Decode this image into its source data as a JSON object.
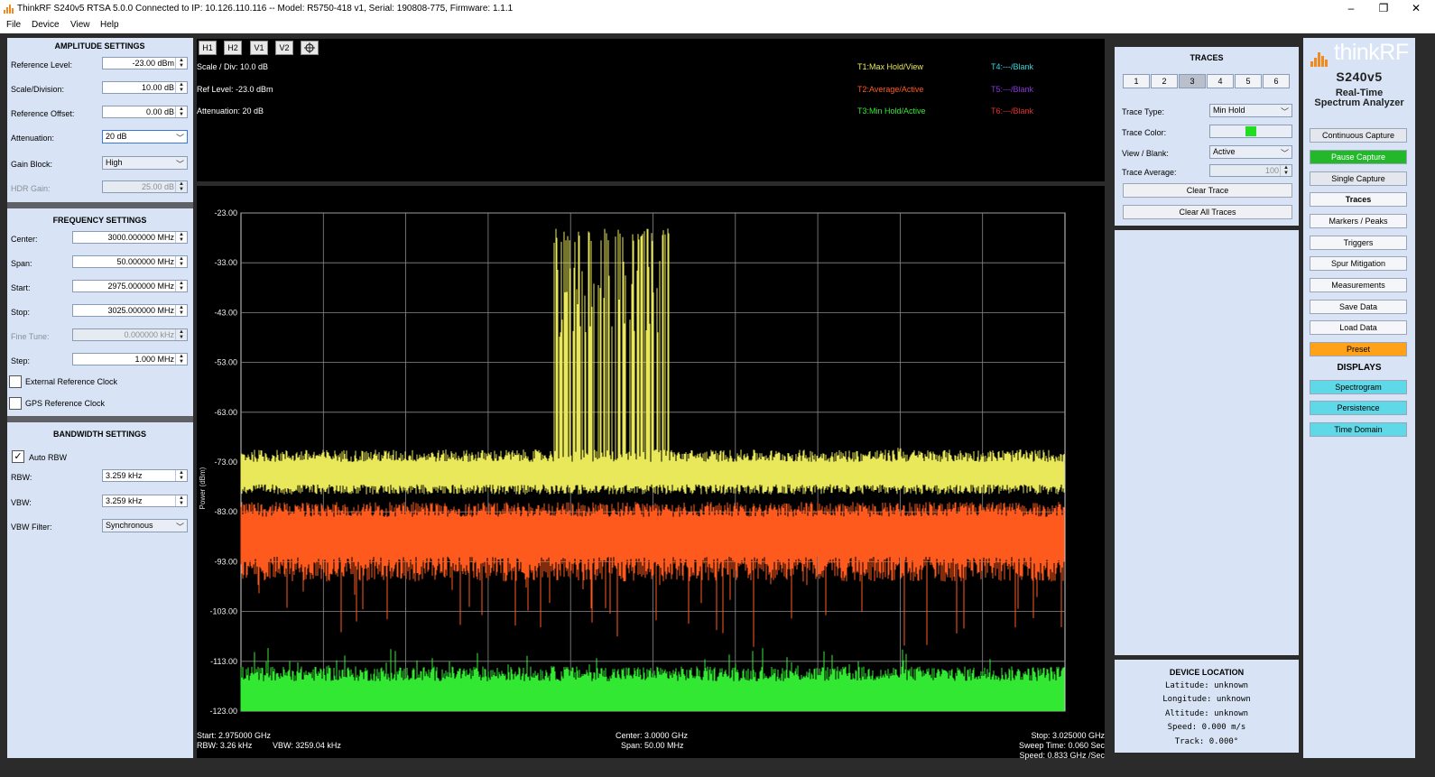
{
  "window": {
    "title": "ThinkRF S240v5 RTSA 5.0.0 Connected to IP: 10.126.110.116 -- Model: R5750-418 v1, Serial: 190808-775, Firmware: 1.1.1",
    "minimize": "–",
    "maximize": "❐",
    "close": "✕"
  },
  "menu": [
    "File",
    "Device",
    "View",
    "Help"
  ],
  "amplitude": {
    "title": "AMPLITUDE SETTINGS",
    "reference_level": {
      "label": "Reference Level:",
      "value": "-23.00 dBm"
    },
    "scale_division": {
      "label": "Scale/Division:",
      "value": "10.00 dB"
    },
    "reference_offset": {
      "label": "Reference Offset:",
      "value": "0.00 dB"
    },
    "attenuation": {
      "label": "Attenuation:",
      "value": "20 dB"
    },
    "gain_block": {
      "label": "Gain Block:",
      "value": "High"
    },
    "hdr_gain": {
      "label": "HDR Gain:",
      "value": "25.00 dB"
    }
  },
  "frequency": {
    "title": "FREQUENCY SETTINGS",
    "center": {
      "label": "Center:",
      "value": "3000.000000 MHz"
    },
    "span": {
      "label": "Span:",
      "value": "50.000000 MHz"
    },
    "start": {
      "label": "Start:",
      "value": "2975.000000 MHz"
    },
    "stop": {
      "label": "Stop:",
      "value": "3025.000000 MHz"
    },
    "fine_tune": {
      "label": "Fine Tune:",
      "value": "0.000000 kHz"
    },
    "step": {
      "label": "Step:",
      "value": "1.000 MHz"
    },
    "ext_ref": "External Reference Clock",
    "gps_ref": "GPS Reference Clock"
  },
  "bandwidth": {
    "title": "BANDWIDTH SETTINGS",
    "auto_rbw": "Auto RBW",
    "rbw": {
      "label": "RBW:",
      "value": "3.259 kHz"
    },
    "vbw": {
      "label": "VBW:",
      "value": "3.259 kHz"
    },
    "vbw_filter": {
      "label": "VBW Filter:",
      "value": "Synchronous"
    }
  },
  "plot_toolbar": [
    "H1",
    "H2",
    "V1",
    "V2"
  ],
  "plot_info": {
    "scale": "Scale / Div: 10.0 dB",
    "ref_level": "Ref Level: -23.0 dBm",
    "attenuation": "Attenuation: 20 dB"
  },
  "trace_legend": [
    {
      "text": "T1:Max Hold/View",
      "color": "#e8e85a"
    },
    {
      "text": "T2:Average/Active",
      "color": "#ff5a1e"
    },
    {
      "text": "T3:Min Hold/Active",
      "color": "#33e833"
    },
    {
      "text": "T4:---/Blank",
      "color": "#33d6e0"
    },
    {
      "text": "T5:---/Blank",
      "color": "#8a35d8"
    },
    {
      "text": "T6:---/Blank",
      "color": "#e03030"
    }
  ],
  "plot_footer": {
    "start": "Start: 2.975000 GHz",
    "rbw": "RBW: 3.26 kHz",
    "vbw": "VBW: 3259.04 kHz",
    "center": "Center: 3.0000 GHz",
    "span": "Span: 50.00 MHz",
    "stop": "Stop: 3.025000 GHz",
    "sweep": "Sweep Time: 0.060 Sec",
    "speed": "Speed: 0.833 GHz /Sec"
  },
  "chart_data": {
    "type": "line",
    "ylabel": "Power (dBm)",
    "ylim": [
      -123,
      -23
    ],
    "xlim": [
      2975,
      3025
    ],
    "yticks": [
      "-23.00",
      "-33.00",
      "-43.00",
      "-53.00",
      "-63.00",
      "-73.00",
      "-83.00",
      "-93.00",
      "-103.00",
      "-113.00",
      "-123.00"
    ],
    "grid": true,
    "series": [
      {
        "name": "T1:Max Hold/View",
        "color": "#e8e85a",
        "noise_floor_dbm": -76,
        "peak_band_mhz": [
          2994,
          3001
        ],
        "peak_dbm": -26,
        "spur_mhz": 3015,
        "spur_dbm": -71
      },
      {
        "name": "T2:Average/Active",
        "color": "#ff5a1e",
        "level_dbm": -88
      },
      {
        "name": "T3:Min Hold/Active",
        "color": "#33e833",
        "level_dbm": -118
      }
    ]
  },
  "traces": {
    "title": "TRACES",
    "tabs": [
      "1",
      "2",
      "3",
      "4",
      "5",
      "6"
    ],
    "selected_tab": "3",
    "trace_type": {
      "label": "Trace Type:",
      "value": "Min Hold"
    },
    "trace_color": {
      "label": "Trace Color:",
      "color": "#22dd22"
    },
    "view_blank": {
      "label": "View / Blank:",
      "value": "Active"
    },
    "trace_average": {
      "label": "Trace Average:",
      "value": "100"
    },
    "clear_trace": "Clear Trace",
    "clear_all": "Clear All Traces"
  },
  "device_location": {
    "title": "DEVICE LOCATION",
    "latitude": "Latitude: unknown",
    "longitude": "Longitude: unknown",
    "altitude": "Altitude: unknown",
    "speed": "Speed: 0.000 m/s",
    "track": "Track: 0.000°"
  },
  "brand": {
    "name": "thinkRF",
    "model": "S240v5",
    "subtitle_line1": "Real-Time",
    "subtitle_line2": "Spectrum Analyzer"
  },
  "controls": {
    "continuous": "Continuous Capture",
    "pause": "Pause Capture",
    "single": "Single Capture",
    "traces": "Traces",
    "markers": "Markers / Peaks",
    "triggers": "Triggers",
    "spur": "Spur Mitigation",
    "measurements": "Measurements",
    "save": "Save Data",
    "load": "Load Data",
    "preset": "Preset",
    "displays_title": "DISPLAYS",
    "spectrogram": "Spectrogram",
    "persistence": "Persistence",
    "time_domain": "Time Domain"
  }
}
